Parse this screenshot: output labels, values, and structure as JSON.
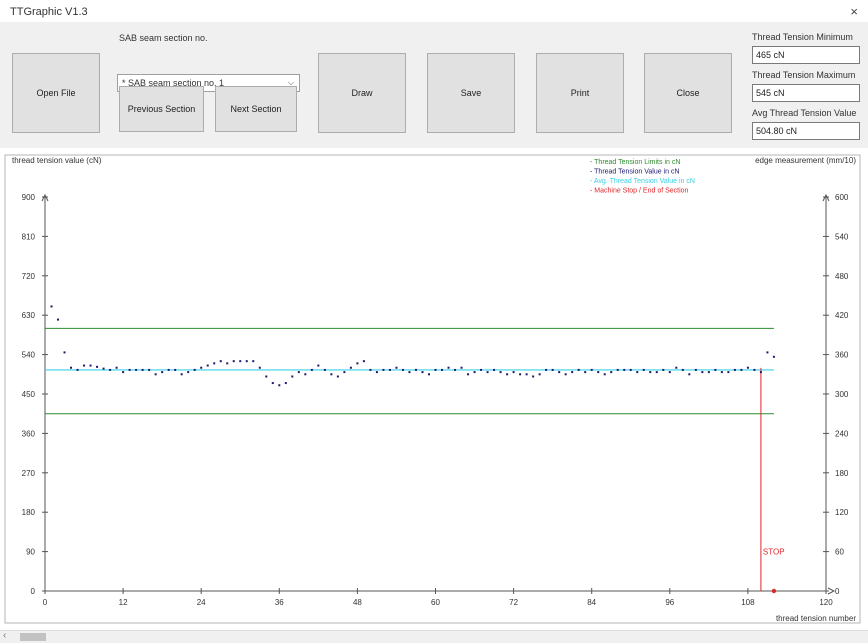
{
  "window": {
    "title": "TTGraphic V1.3",
    "close": "×"
  },
  "toolbar": {
    "open_file": "Open File",
    "section_label": "SAB seam section no.",
    "section_selected": "* SAB seam section no. 1",
    "prev_section": "Previous Section",
    "next_section": "Next Section",
    "draw": "Draw",
    "save": "Save",
    "print": "Print",
    "close": "Close"
  },
  "stats": {
    "min_label": "Thread Tension Minimum",
    "min_value": "465 cN",
    "max_label": "Thread Tension Maximum",
    "max_value": "545 cN",
    "avg_label": "Avg Thread Tension Value",
    "avg_value": "504.80 cN"
  },
  "colors": {
    "limit": "#2e8b2e",
    "value": "#1a1a6e",
    "avg": "#39d0e6",
    "stop": "#e0262b"
  },
  "chart_data": {
    "type": "scatter",
    "ylabel_left": "thread tension value (cN)",
    "ylabel_right": "edge measurement (mm/10)",
    "xlabel": "thread tension number",
    "xlim": [
      0,
      120
    ],
    "ylim_left": [
      0,
      900
    ],
    "ylim_right": [
      0,
      600
    ],
    "x_ticks": [
      0,
      12,
      24,
      36,
      48,
      60,
      72,
      84,
      96,
      108,
      120
    ],
    "y_ticks_left": [
      0,
      90,
      180,
      270,
      360,
      450,
      540,
      630,
      720,
      810,
      900
    ],
    "y_ticks_right": [
      0,
      60,
      120,
      180,
      240,
      300,
      360,
      420,
      480,
      540,
      600
    ],
    "legend": [
      {
        "label": "- Thread Tension Limits in cN",
        "color": "#2e8b2e"
      },
      {
        "label": "- Thread Tension Value in cN",
        "color": "#1a1a6e"
      },
      {
        "label": "- Avg. Thread Tension Value in cN",
        "color": "#39d0e6"
      },
      {
        "label": "- Machine Stop / End of Section",
        "color": "#e0262b"
      }
    ],
    "limit_upper": 600,
    "limit_lower": 405,
    "avg": 505,
    "limits_x_end": 112,
    "stop_x": 110,
    "stop_label": "STOP",
    "series": [
      {
        "x": [
          1,
          2,
          3,
          4,
          5,
          6,
          7,
          8,
          9,
          10,
          11,
          12,
          13,
          14,
          15,
          16,
          17,
          18,
          19,
          20,
          21,
          22,
          23,
          24,
          25,
          26,
          27,
          28,
          29,
          30,
          31,
          32,
          33,
          34,
          35,
          36,
          37,
          38,
          39,
          40,
          41,
          42,
          43,
          44,
          45,
          46,
          47,
          48,
          49,
          50,
          51,
          52,
          53,
          54,
          55,
          56,
          57,
          58,
          59,
          60,
          61,
          62,
          63,
          64,
          65,
          66,
          67,
          68,
          69,
          70,
          71,
          72,
          73,
          74,
          75,
          76,
          77,
          78,
          79,
          80,
          81,
          82,
          83,
          84,
          85,
          86,
          87,
          88,
          89,
          90,
          91,
          92,
          93,
          94,
          95,
          96,
          97,
          98,
          99,
          100,
          101,
          102,
          103,
          104,
          105,
          106,
          107,
          108,
          109,
          110,
          111,
          112
        ],
        "y": [
          650,
          620,
          545,
          510,
          505,
          515,
          515,
          512,
          508,
          505,
          510,
          500,
          505,
          505,
          505,
          505,
          495,
          500,
          505,
          505,
          495,
          500,
          505,
          510,
          515,
          520,
          525,
          520,
          525,
          525,
          525,
          525,
          510,
          490,
          475,
          470,
          475,
          490,
          500,
          495,
          505,
          515,
          505,
          495,
          490,
          500,
          510,
          520,
          525,
          505,
          500,
          505,
          505,
          510,
          505,
          500,
          505,
          500,
          495,
          505,
          505,
          510,
          505,
          510,
          495,
          500,
          505,
          500,
          505,
          500,
          495,
          500,
          495,
          495,
          490,
          495,
          505,
          505,
          500,
          495,
          500,
          505,
          500,
          505,
          500,
          495,
          500,
          505,
          505,
          505,
          500,
          505,
          500,
          500,
          505,
          500,
          510,
          505,
          495,
          505,
          500,
          500,
          505,
          500,
          500,
          505,
          505,
          510,
          505,
          500,
          545,
          535
        ]
      }
    ]
  }
}
